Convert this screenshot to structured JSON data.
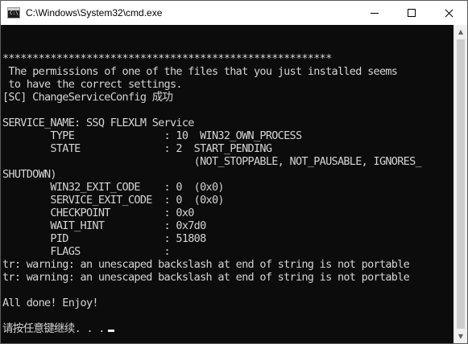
{
  "window": {
    "title": "C:\\Windows\\System32\\cmd.exe"
  },
  "icons": {
    "app": "cmd-app-icon",
    "minimize": "minimize-icon",
    "maximize": "maximize-icon",
    "close": "close-icon",
    "scroll_up": "scroll-up-arrow-icon",
    "scroll_down": "scroll-down-arrow-icon"
  },
  "colors": {
    "console_background": "#0c0c0c",
    "console_text": "#d4d4d4"
  },
  "console": {
    "lines": [
      "",
      "",
      "*******************************************************",
      " The permissions of one of the files that you just installed seems",
      " to have the correct settings.",
      "[SC] ChangeServiceConfig 成功",
      "",
      "SERVICE_NAME: SSQ FLEXLM Service",
      "        TYPE               : 10  WIN32_OWN_PROCESS",
      "        STATE              : 2  START_PENDING",
      "                                (NOT_STOPPABLE, NOT_PAUSABLE, IGNORES_",
      "SHUTDOWN)",
      "        WIN32_EXIT_CODE    : 0  (0x0)",
      "        SERVICE_EXIT_CODE  : 0  (0x0)",
      "        CHECKPOINT         : 0x0",
      "        WAIT_HINT          : 0x7d0",
      "        PID                : 51808",
      "        FLAGS              :",
      "tr: warning: an unescaped backslash at end of string is not portable",
      "tr: warning: an unescaped backslash at end of string is not portable",
      "",
      "All done! Enjoy!",
      "",
      "请按任意键继续. . ."
    ]
  }
}
